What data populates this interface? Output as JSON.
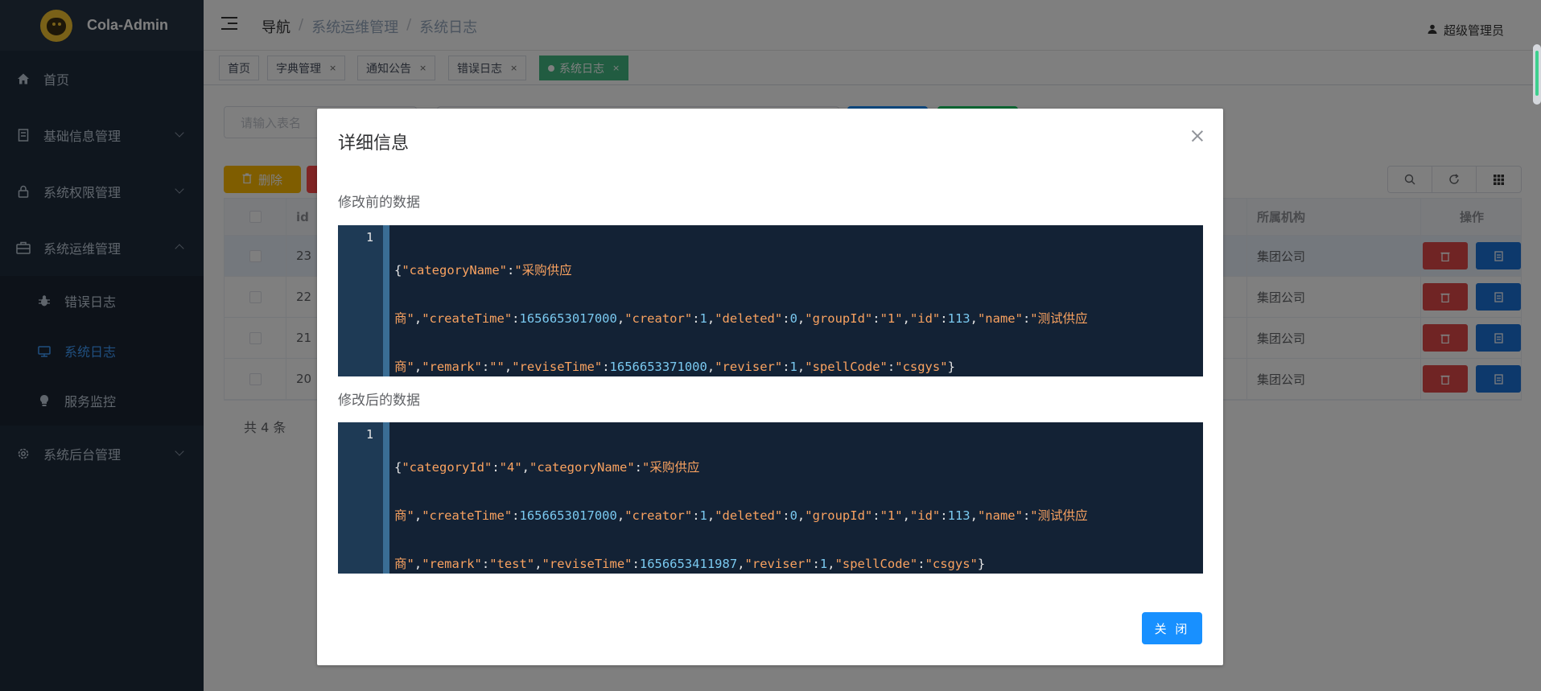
{
  "app": {
    "title": "Cola-Admin"
  },
  "sidebar": {
    "items": [
      {
        "label": "首页",
        "icon": "home-icon"
      },
      {
        "label": "基础信息管理",
        "icon": "doc-icon"
      },
      {
        "label": "系统权限管理",
        "icon": "lock-icon"
      },
      {
        "label": "系统运维管理",
        "icon": "toolbox-icon"
      },
      {
        "label": "系统后台管理",
        "icon": "gear-icon"
      }
    ],
    "sub_items": [
      {
        "label": "错误日志",
        "icon": "bug-icon"
      },
      {
        "label": "系统日志",
        "icon": "log-icon"
      },
      {
        "label": "服务监控",
        "icon": "bulb-icon"
      }
    ]
  },
  "header": {
    "breadcrumb": [
      "导航",
      "系统运维管理",
      "系统日志"
    ],
    "breadcrumb_sep": "/",
    "user": "超级管理员"
  },
  "tags": [
    {
      "label": "首页"
    },
    {
      "label": "字典管理"
    },
    {
      "label": "通知公告"
    },
    {
      "label": "错误日志"
    },
    {
      "label": "系统日志"
    }
  ],
  "tag_close": "×",
  "toolbar": {
    "search_placeholder": "请输入表名",
    "delete_label": "删除"
  },
  "table": {
    "columns": {
      "id": "id",
      "org": "所属机构",
      "op": "操作"
    },
    "rows": [
      {
        "id": "23",
        "org": "集团公司"
      },
      {
        "id": "22",
        "org": "集团公司"
      },
      {
        "id": "21",
        "org": "集团公司"
      },
      {
        "id": "20",
        "org": "集团公司"
      }
    ]
  },
  "pager": {
    "total": "共 4 条"
  },
  "dialog": {
    "title": "详细信息",
    "before_label": "修改前的数据",
    "after_label": "修改后的数据",
    "line_number": "1",
    "close_button": "关 闭",
    "before_code": [
      "{\"categoryName\":\"采购供应",
      "商\",\"createTime\":1656653017000,\"creator\":1,\"deleted\":0,\"groupId\":\"1\",\"id\":113,\"name\":\"测试供应",
      "商\",\"remark\":\"\",\"reviseTime\":1656653371000,\"reviser\":1,\"spellCode\":\"csgys\"}"
    ],
    "after_code": [
      "{\"categoryId\":\"4\",\"categoryName\":\"采购供应",
      "商\",\"createTime\":1656653017000,\"creator\":1,\"deleted\":0,\"groupId\":\"1\",\"id\":113,\"name\":\"测试供应",
      "商\",\"remark\":\"test\",\"reviseTime\":1656653411987,\"reviser\":1,\"spellCode\":\"csgys\"}"
    ]
  },
  "colors": {
    "sidebar_bg": "#1f2d3d",
    "active_menu": "#409eff",
    "tag_active": "#42b983",
    "primary": "#1890ff",
    "code_bg": "#132235",
    "code_key": "#f9a260",
    "code_num": "#7ac9f0"
  }
}
